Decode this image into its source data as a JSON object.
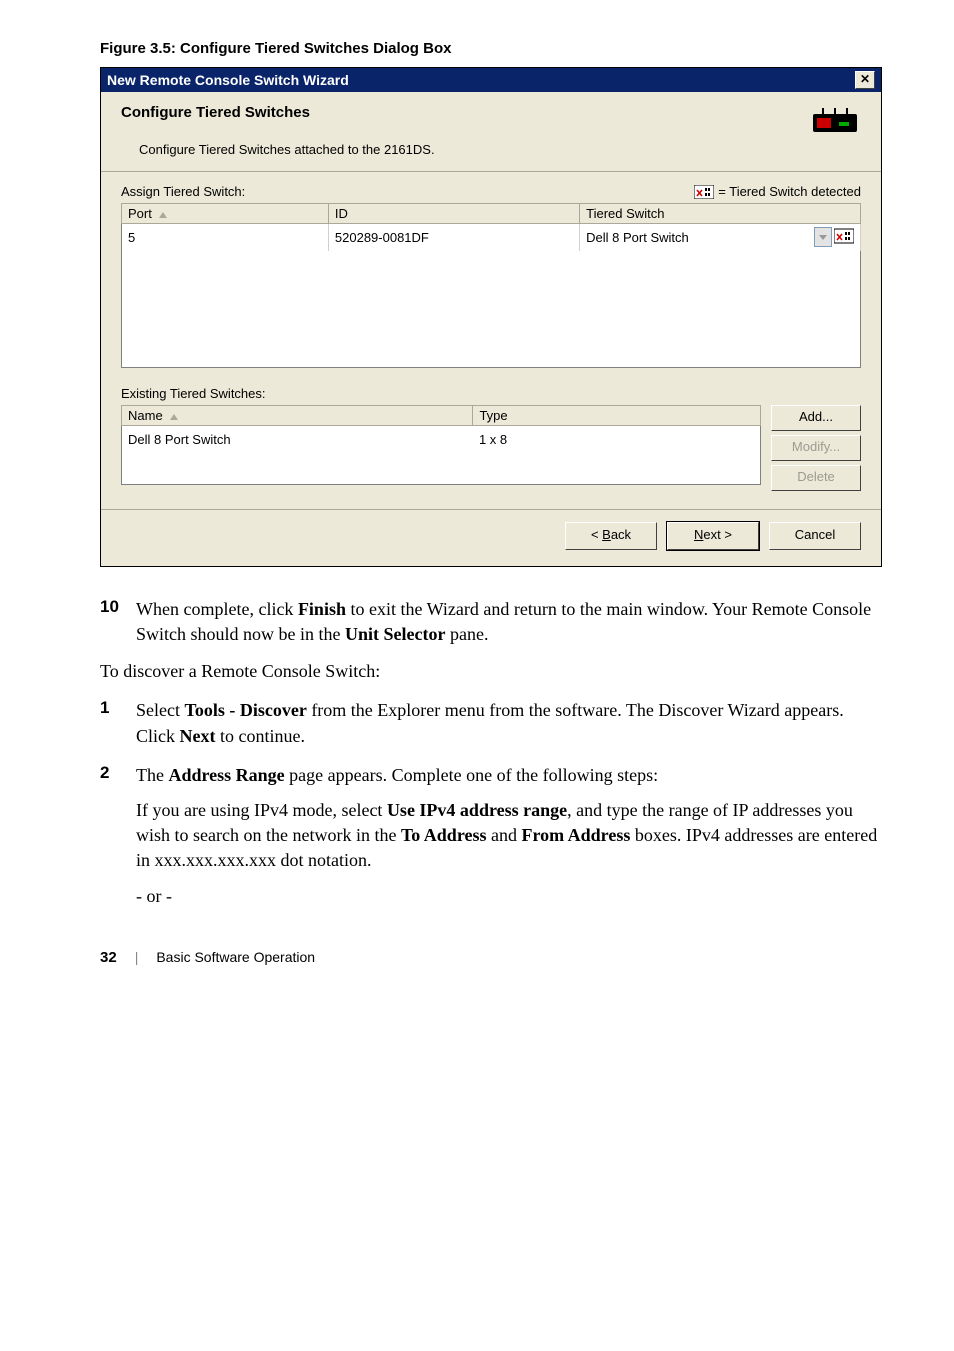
{
  "figure_caption": "Figure 3.5: Configure Tiered Switches Dialog Box",
  "dialog": {
    "title": "New Remote Console Switch Wizard",
    "header_title": "Configure Tiered Switches",
    "header_sub": "Configure Tiered Switches attached to the 2161DS.",
    "assign_label": "Assign Tiered Switch:",
    "legend_text": " = Tiered Switch detected",
    "table1": {
      "headers": {
        "port": "Port",
        "id": "ID",
        "tiered": "Tiered Switch"
      },
      "row": {
        "port": "5",
        "id": "520289-0081DF",
        "tiered": "Dell 8 Port Switch"
      }
    },
    "existing_label": "Existing Tiered Switches:",
    "table2": {
      "headers": {
        "name": "Name",
        "type": "Type"
      },
      "row": {
        "name": "Dell 8 Port Switch",
        "type": "1 x 8"
      }
    },
    "buttons": {
      "add": "Add...",
      "modify": "Modify...",
      "delete": "Delete"
    },
    "nav": {
      "back": "< Back",
      "next": "Next >",
      "cancel": "Cancel"
    },
    "nav_underline": {
      "back_char": "B",
      "next_char": "N"
    }
  },
  "steps": {
    "s10_a": "When complete, click ",
    "s10_bold1": "Finish",
    "s10_b": " to exit the Wizard and return to the main window. Your Remote Console Switch should now be in the ",
    "s10_bold2": "Unit Selector",
    "s10_c": " pane.",
    "intro": "To discover a Remote Console Switch:",
    "s1_a": "Select ",
    "s1_bold1": "Tools - Discover",
    "s1_b": " from the Explorer menu from the software. The Discover Wizard appears. Click ",
    "s1_bold2": "Next",
    "s1_c": " to continue.",
    "s2_a": "The ",
    "s2_bold1": "Address Range",
    "s2_b": " page appears. Complete one of the following steps:",
    "s2_p2_a": "If you are using IPv4 mode, select ",
    "s2_p2_bold1": "Use IPv4 address range",
    "s2_p2_b": ", and type the range of IP addresses you wish to search on the network in the ",
    "s2_p2_bold2": "To Address",
    "s2_p2_c": " and ",
    "s2_p2_bold3": "From Address",
    "s2_p2_d": " boxes. IPv4 addresses are entered in xxx.xxx.xxx.xxx dot notation.",
    "s2_p3": "- or -"
  },
  "numbers": {
    "n10": "10",
    "n1": "1",
    "n2": "2"
  },
  "footer": {
    "page": "32",
    "section": "Basic Software Operation"
  }
}
